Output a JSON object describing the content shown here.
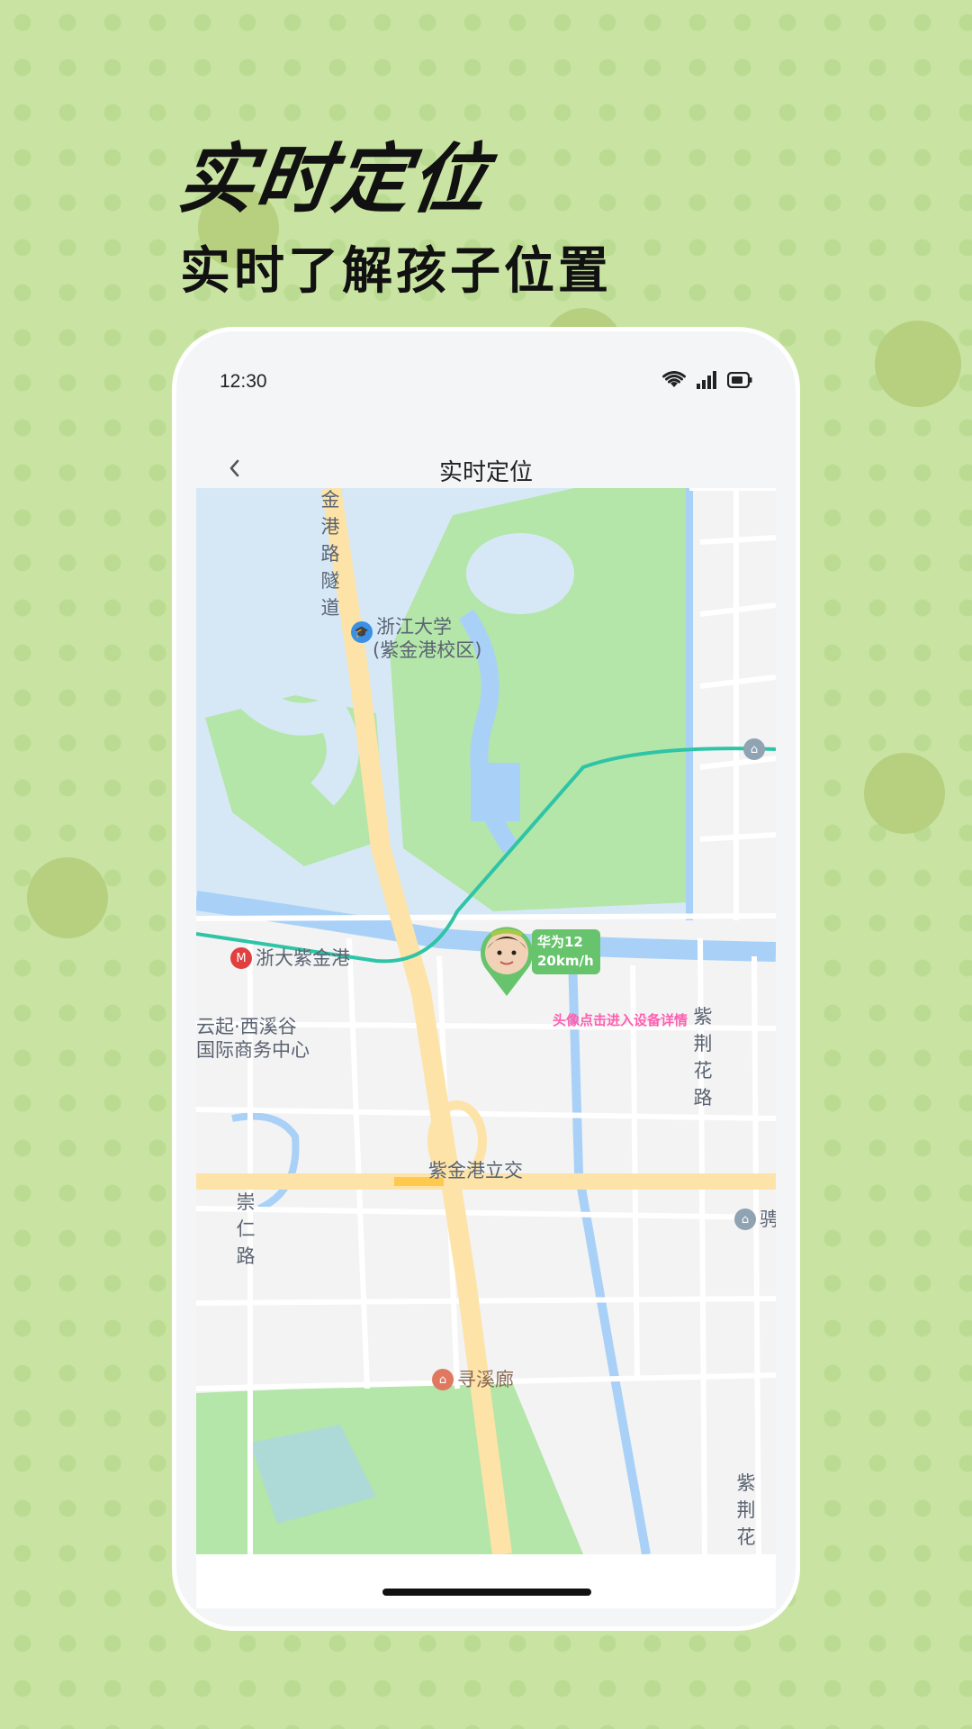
{
  "hero": {
    "title": "实时定位",
    "subtitle": "实时了解孩子位置"
  },
  "status_bar": {
    "time": "12:30",
    "icons": [
      "wifi-icon",
      "signal-icon",
      "battery-icon"
    ]
  },
  "nav": {
    "back_icon": "chevron-left-icon",
    "title": "实时定位"
  },
  "map": {
    "labels": {
      "road_north": "金港路隧道",
      "university_line1": "浙江大学",
      "university_line2": "(紫金港校区)",
      "metro_station": "浙大紫金港",
      "business_line1": "云起·西溪谷",
      "business_line2": "国际商务中心",
      "road_zijinghua_1": "紫荆花路",
      "interchange": "紫金港立交",
      "road_chongren": "崇仁路",
      "right_poi": "骋",
      "xunxilang": "寻溪廊",
      "road_zijinghua_2": "紫荆花路"
    },
    "colors": {
      "water": "#a9d1f7",
      "lake": "#d6e8f6",
      "park": "#b3e6a8",
      "road": "#ffffff",
      "highway": "#fde3a7",
      "metro": "#2ec4a6",
      "land": "#f3f3f3"
    }
  },
  "device": {
    "name": "华为12",
    "speed": "20km/h",
    "avatar_icon": "child-avatar-icon",
    "marker_color": "#67c46d"
  },
  "hint": {
    "text": "头像点击进入设备详情"
  }
}
